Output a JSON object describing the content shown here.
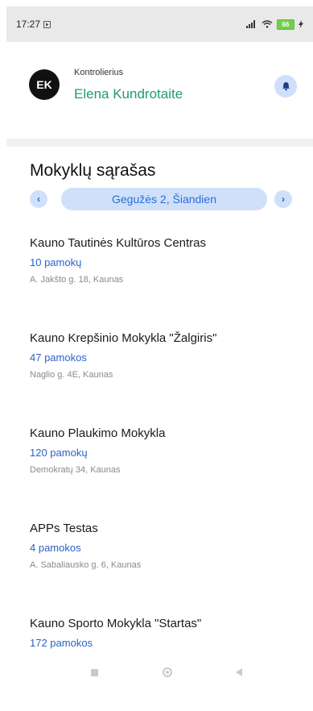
{
  "status_bar": {
    "time": "17:27",
    "battery_level": "66",
    "icons": [
      "play-icon",
      "signal-icon",
      "wifi-icon",
      "battery-icon",
      "charging-icon"
    ]
  },
  "header": {
    "avatar_initials": "EK",
    "role": "Kontrolierius",
    "user_name": "Elena Kundrotaite",
    "icons": [
      "bell-icon"
    ]
  },
  "page": {
    "title": "Mokyklų sąrašas",
    "date_label": "Gegužės 2, Šiandien",
    "prev_label": "‹",
    "next_label": "›"
  },
  "schools": [
    {
      "name": "Kauno Tautinės Kultūros Centras",
      "lessons": "10 pamokų",
      "address": "A. Jakšto g. 18, Kaunas"
    },
    {
      "name": "Kauno Krepšinio Mokykla \"Žalgiris\"",
      "lessons": "47 pamokos",
      "address": "Naglio g. 4E, Kaunas"
    },
    {
      "name": "Kauno Plaukimo Mokykla",
      "lessons": "120 pamokų",
      "address": "Demokratų 34, Kaunas"
    },
    {
      "name": "APPs Testas",
      "lessons": "4 pamokos",
      "address": "A. Sabaliausko g. 6, Kaunas"
    },
    {
      "name": "Kauno Sporto Mokykla \"Startas\"",
      "lessons": "172 pamokos",
      "address": ""
    }
  ],
  "colors": {
    "accent_green": "#1e9d6a",
    "accent_blue": "#2a62c9",
    "pill_bg": "#cfe0fb",
    "status_bar_bg": "#e9e9e9"
  },
  "system_nav": [
    "recents-icon",
    "home-icon",
    "back-icon"
  ]
}
